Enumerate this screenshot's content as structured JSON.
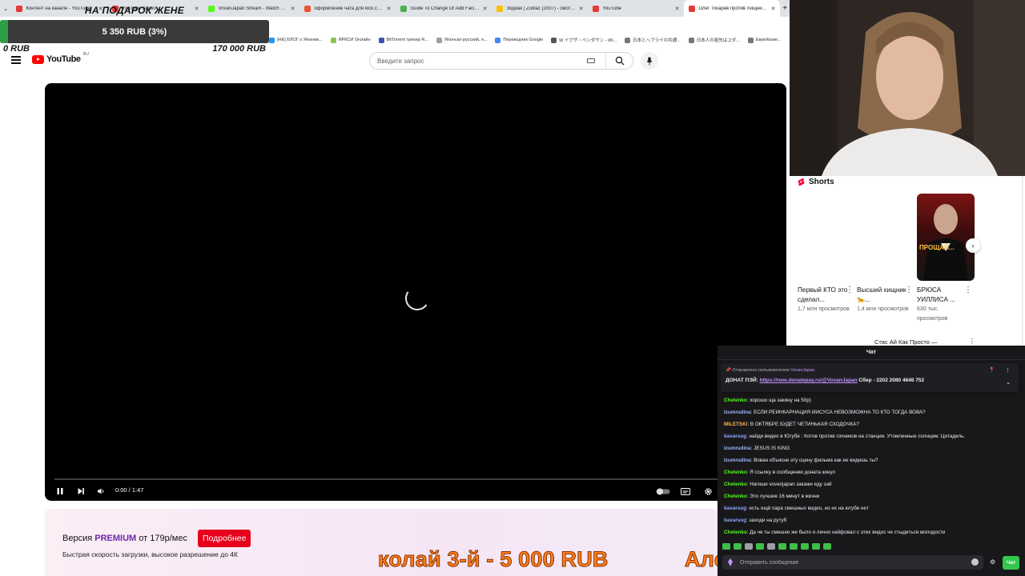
{
  "browser": {
    "tabs": [
      {
        "label": "Контент на канале - YouTube",
        "color": "#e53935",
        "active": false
      },
      {
        "label": "YouTube Studio",
        "color": "#e53935",
        "active": false
      },
      {
        "label": "VovanJapan Stream - Watch Li...",
        "color": "#53fc18",
        "active": false
      },
      {
        "label": "оформление чата для kick.com",
        "color": "#e8552b",
        "active": false
      },
      {
        "label": "Guide To Change Or Add Facili...",
        "color": "#4caf50",
        "active": false
      },
      {
        "label": "Зодиак | Zodiac (2007) - смотр...",
        "color": "#f9c100",
        "active": false
      },
      {
        "label": "YouTube",
        "color": "#e53935",
        "active": false
      },
      {
        "label": "Олег Токарев против Хищника...",
        "color": "#e53935",
        "active": true
      }
    ],
    "bookmarks": [
      {
        "label": "[НЕ] БЛОГ о Японии...",
        "color": "#2196f3"
      },
      {
        "label": "ЯРКСИ Онлайн",
        "color": "#8bc34a"
      },
      {
        "label": "BitTorrent трекер R...",
        "color": "#3f51b5"
      },
      {
        "label": "Японско-русский, я...",
        "color": "#9e9e9e"
      },
      {
        "label": "Переводчик Google",
        "color": "#4285f4"
      },
      {
        "label": "W イグザ・ペンダサン - Wi...",
        "color": "#555555"
      },
      {
        "label": "日本とヘブライの共通...",
        "color": "#777777"
      },
      {
        "label": "日本人の祖先はユダ...",
        "color": "#777777"
      },
      {
        "label": "Еврейские...",
        "color": "#777777"
      }
    ]
  },
  "goal": {
    "title": "НА ПОДАРОК ЖЕНЕ",
    "amount": "5 350 RUB (3%)",
    "progress_fraction": 0.031,
    "min": "0 RUB",
    "max": "170 000 RUB",
    "fill_color": "#2ea043"
  },
  "youtube": {
    "logo_text": "YouTube",
    "region": "RU",
    "search_placeholder": "Введите запрос",
    "player": {
      "time": "0:00 / 1:47",
      "icons": [
        "pause-icon",
        "next-icon",
        "volume-icon",
        "autoplay-toggle",
        "subtitles-icon",
        "settings-icon"
      ]
    },
    "premium": {
      "version_label": "Версия",
      "premium_word": "PREMIUM",
      "price": "от 179р/мес",
      "button": "Подробнее",
      "subtitle": "Быстрая скорость загрузки, высокое разрешение до 4К",
      "button_color": "#e7001b"
    },
    "shorts": {
      "title": "Shorts",
      "items": [
        {
          "title": "Первый КТО это сделал...",
          "views": "1,7 млн просмотров"
        },
        {
          "title": "Высший хищник 🐆...",
          "views": "1,4 млн просмотров"
        },
        {
          "title": "БРЮСА УИЛЛИСА ...",
          "views": "630 тыс. просмотров"
        }
      ],
      "thumb_caption": "ПРОЩАЙ...",
      "next_video_peek": "Стас Ай Как Просто —"
    }
  },
  "ticker": {
    "left_text": "колай 3-й - 5 000 RUB",
    "right_text": "Алс",
    "color": "#ff7f1a"
  },
  "chat": {
    "header": "Чат",
    "pinned": {
      "sent_by_label": "Отправлено пользователем",
      "sent_by_user": "VovanJapan",
      "prefix": "ДОНАТ ПЭЙ: ",
      "link": "https://new.donatepay.ru/@VovanJapan",
      "suffix": " Сбер - 2202 2080 4648 752"
    },
    "messages": [
      {
        "user": "Chetenko",
        "color": "#53fc18",
        "text": ": хорошо ща закину на 50р)"
      },
      {
        "user": "Izumrudina",
        "color": "#9bb7ff",
        "text": ": ЕСЛИ РЕИНКАРНАЦИЯ ИИСУСА НЕВОЗМОЖНА ТО КТО ТОГДА ВОВА?"
      },
      {
        "user": "MILETSKI",
        "color": "#ffb347",
        "text": ": В ОКТЯБРЕ БУДЕТ ЧЕТИНЬКАЯ СХОДОЧКА?"
      },
      {
        "user": "bavarsog",
        "color": "#8fa8ff",
        "text": ": найди видео в Ютубе : Котов против гопников на станции. Утомленные солнцем: Цитадель."
      },
      {
        "user": "Izumrudina",
        "color": "#9bb7ff",
        "text": ": JESUS IS KING"
      },
      {
        "user": "Izumrudina",
        "color": "#9bb7ff",
        "text": ": Вован объясни эту сцену фильма как ее видишь ты?"
      },
      {
        "user": "Chetenko",
        "color": "#53fc18",
        "text": ": Я ссылку в сообщении доната кинул"
      },
      {
        "user": "Chetenko",
        "color": "#53fc18",
        "text": ": Нагиши vovanjapan закажи еду ээй"
      },
      {
        "user": "Chetenko",
        "color": "#53fc18",
        "text": ": Это лучшие 16 минут в жизни"
      },
      {
        "user": "bavarsog",
        "color": "#8fa8ff",
        "text": ": есть ещё пара смешных видео, но их на ютубе нет"
      },
      {
        "user": "bavarsog",
        "color": "#8fa8ff",
        "text": ": заходи на рутуб"
      },
      {
        "user": "Chetenko",
        "color": "#53fc18",
        "text": ": Да че ты смешно же было я лично кайфовал с этих видос че стыдиться молодости"
      }
    ],
    "input_placeholder": "Отправить сообщение",
    "send_button": "Чат",
    "send_color": "#33c74d"
  }
}
